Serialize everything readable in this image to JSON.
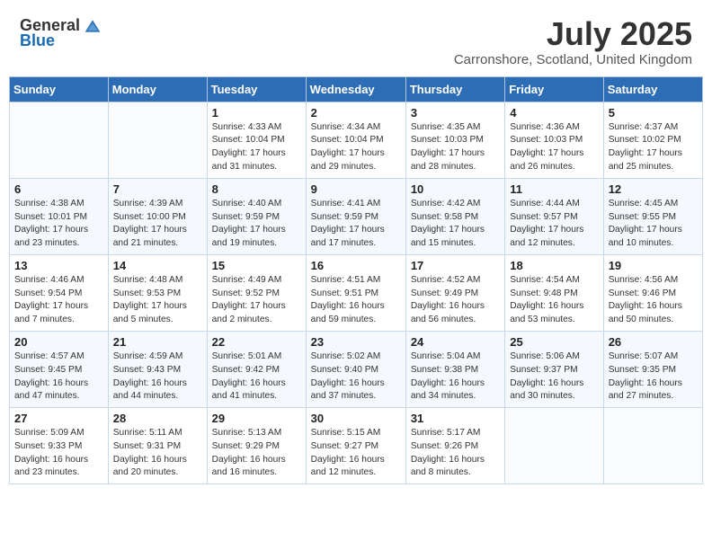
{
  "header": {
    "logo_general": "General",
    "logo_blue": "Blue",
    "month": "July 2025",
    "location": "Carronshore, Scotland, United Kingdom"
  },
  "weekdays": [
    "Sunday",
    "Monday",
    "Tuesday",
    "Wednesday",
    "Thursday",
    "Friday",
    "Saturday"
  ],
  "weeks": [
    [
      {
        "day": "",
        "text": ""
      },
      {
        "day": "",
        "text": ""
      },
      {
        "day": "1",
        "text": "Sunrise: 4:33 AM\nSunset: 10:04 PM\nDaylight: 17 hours and 31 minutes."
      },
      {
        "day": "2",
        "text": "Sunrise: 4:34 AM\nSunset: 10:04 PM\nDaylight: 17 hours and 29 minutes."
      },
      {
        "day": "3",
        "text": "Sunrise: 4:35 AM\nSunset: 10:03 PM\nDaylight: 17 hours and 28 minutes."
      },
      {
        "day": "4",
        "text": "Sunrise: 4:36 AM\nSunset: 10:03 PM\nDaylight: 17 hours and 26 minutes."
      },
      {
        "day": "5",
        "text": "Sunrise: 4:37 AM\nSunset: 10:02 PM\nDaylight: 17 hours and 25 minutes."
      }
    ],
    [
      {
        "day": "6",
        "text": "Sunrise: 4:38 AM\nSunset: 10:01 PM\nDaylight: 17 hours and 23 minutes."
      },
      {
        "day": "7",
        "text": "Sunrise: 4:39 AM\nSunset: 10:00 PM\nDaylight: 17 hours and 21 minutes."
      },
      {
        "day": "8",
        "text": "Sunrise: 4:40 AM\nSunset: 9:59 PM\nDaylight: 17 hours and 19 minutes."
      },
      {
        "day": "9",
        "text": "Sunrise: 4:41 AM\nSunset: 9:59 PM\nDaylight: 17 hours and 17 minutes."
      },
      {
        "day": "10",
        "text": "Sunrise: 4:42 AM\nSunset: 9:58 PM\nDaylight: 17 hours and 15 minutes."
      },
      {
        "day": "11",
        "text": "Sunrise: 4:44 AM\nSunset: 9:57 PM\nDaylight: 17 hours and 12 minutes."
      },
      {
        "day": "12",
        "text": "Sunrise: 4:45 AM\nSunset: 9:55 PM\nDaylight: 17 hours and 10 minutes."
      }
    ],
    [
      {
        "day": "13",
        "text": "Sunrise: 4:46 AM\nSunset: 9:54 PM\nDaylight: 17 hours and 7 minutes."
      },
      {
        "day": "14",
        "text": "Sunrise: 4:48 AM\nSunset: 9:53 PM\nDaylight: 17 hours and 5 minutes."
      },
      {
        "day": "15",
        "text": "Sunrise: 4:49 AM\nSunset: 9:52 PM\nDaylight: 17 hours and 2 minutes."
      },
      {
        "day": "16",
        "text": "Sunrise: 4:51 AM\nSunset: 9:51 PM\nDaylight: 16 hours and 59 minutes."
      },
      {
        "day": "17",
        "text": "Sunrise: 4:52 AM\nSunset: 9:49 PM\nDaylight: 16 hours and 56 minutes."
      },
      {
        "day": "18",
        "text": "Sunrise: 4:54 AM\nSunset: 9:48 PM\nDaylight: 16 hours and 53 minutes."
      },
      {
        "day": "19",
        "text": "Sunrise: 4:56 AM\nSunset: 9:46 PM\nDaylight: 16 hours and 50 minutes."
      }
    ],
    [
      {
        "day": "20",
        "text": "Sunrise: 4:57 AM\nSunset: 9:45 PM\nDaylight: 16 hours and 47 minutes."
      },
      {
        "day": "21",
        "text": "Sunrise: 4:59 AM\nSunset: 9:43 PM\nDaylight: 16 hours and 44 minutes."
      },
      {
        "day": "22",
        "text": "Sunrise: 5:01 AM\nSunset: 9:42 PM\nDaylight: 16 hours and 41 minutes."
      },
      {
        "day": "23",
        "text": "Sunrise: 5:02 AM\nSunset: 9:40 PM\nDaylight: 16 hours and 37 minutes."
      },
      {
        "day": "24",
        "text": "Sunrise: 5:04 AM\nSunset: 9:38 PM\nDaylight: 16 hours and 34 minutes."
      },
      {
        "day": "25",
        "text": "Sunrise: 5:06 AM\nSunset: 9:37 PM\nDaylight: 16 hours and 30 minutes."
      },
      {
        "day": "26",
        "text": "Sunrise: 5:07 AM\nSunset: 9:35 PM\nDaylight: 16 hours and 27 minutes."
      }
    ],
    [
      {
        "day": "27",
        "text": "Sunrise: 5:09 AM\nSunset: 9:33 PM\nDaylight: 16 hours and 23 minutes."
      },
      {
        "day": "28",
        "text": "Sunrise: 5:11 AM\nSunset: 9:31 PM\nDaylight: 16 hours and 20 minutes."
      },
      {
        "day": "29",
        "text": "Sunrise: 5:13 AM\nSunset: 9:29 PM\nDaylight: 16 hours and 16 minutes."
      },
      {
        "day": "30",
        "text": "Sunrise: 5:15 AM\nSunset: 9:27 PM\nDaylight: 16 hours and 12 minutes."
      },
      {
        "day": "31",
        "text": "Sunrise: 5:17 AM\nSunset: 9:26 PM\nDaylight: 16 hours and 8 minutes."
      },
      {
        "day": "",
        "text": ""
      },
      {
        "day": "",
        "text": ""
      }
    ]
  ]
}
